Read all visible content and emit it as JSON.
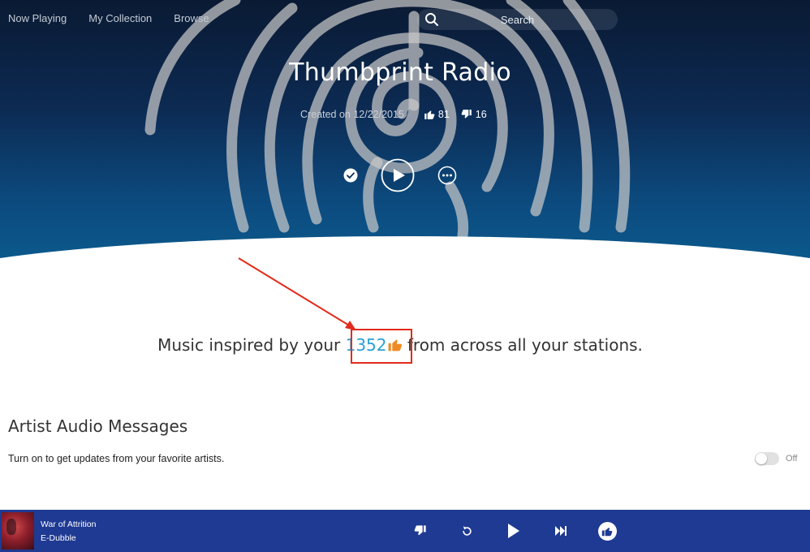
{
  "nav": {
    "items": [
      "Now Playing",
      "My Collection",
      "Browse"
    ],
    "search_placeholder": "Search"
  },
  "station": {
    "title": "Thumbprint Radio",
    "created": "Created on 12/22/2015",
    "thumbs_up": "81",
    "thumbs_down": "16"
  },
  "description": {
    "before": "Music inspired by your ",
    "count": "1352",
    "after": " from across all your stations."
  },
  "artist_messages": {
    "title": "Artist Audio Messages",
    "description": "Turn on to get updates from your favorite artists.",
    "toggle_label": "Off",
    "toggle_on": false
  },
  "player": {
    "song": "War of Attrition",
    "artist": "E-Dubble"
  },
  "colors": {
    "hero_top": "#0a1a33",
    "hero_bottom": "#0b5b8e",
    "player_bar": "#1f3a93",
    "count_link": "#2a9fd6",
    "annotation": "#e32b1a",
    "thumb_orange": "#f08a24"
  },
  "icons": {
    "search": "search-icon",
    "collected": "check-circle-icon",
    "play": "play-icon",
    "more": "more-options-icon",
    "thumb_up": "thumb-up-icon",
    "thumb_down": "thumb-down-icon",
    "replay": "replay-icon",
    "skip": "skip-icon"
  }
}
